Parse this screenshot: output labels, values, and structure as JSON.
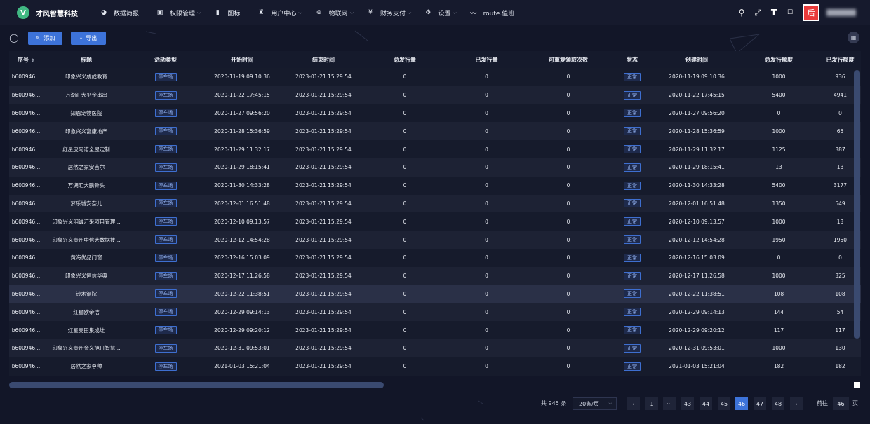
{
  "app": {
    "logo_letter": "V",
    "name": "才风智慧科技"
  },
  "menu": [
    {
      "icon": "dashboard-icon",
      "glyph": "◕",
      "label": "数据简报",
      "has_dropdown": false
    },
    {
      "icon": "lock-icon",
      "glyph": "▣",
      "label": "权限管理",
      "has_dropdown": true
    },
    {
      "icon": "image-icon",
      "glyph": "▮",
      "label": "图标",
      "has_dropdown": false
    },
    {
      "icon": "user-icon",
      "glyph": "♜",
      "label": "用户中心",
      "has_dropdown": true
    },
    {
      "icon": "network-icon",
      "glyph": "⊕",
      "label": "物联网",
      "has_dropdown": true
    },
    {
      "icon": "yen-icon",
      "glyph": "¥",
      "label": "财务支付",
      "has_dropdown": true
    },
    {
      "icon": "gear-icon",
      "glyph": "⚙",
      "label": "设置",
      "has_dropdown": true
    },
    {
      "icon": "route-icon",
      "glyph": "〰",
      "label": "route.值班",
      "has_dropdown": false
    }
  ],
  "header_right": {
    "avatar_glyph": "后"
  },
  "toolbar": {
    "add_label": "添加",
    "export_label": "导出"
  },
  "table": {
    "columns": [
      "序号",
      "标题",
      "活动类型",
      "开始时间",
      "结束时间",
      "总发行量",
      "已发行量",
      "可重复领取次数",
      "状态",
      "创建时间",
      "总发行额度",
      "已发行额度"
    ],
    "rows": [
      [
        "b600946...",
        "印象兴义成成教育",
        "停车场",
        "2020-11-19 09:10:36",
        "2023-01-21 15:29:54",
        "0",
        "0",
        "0",
        "正常",
        "2020-11-19 09:10:36",
        "1000",
        "936"
      ],
      [
        "b600946...",
        "万湖汇大平金串串",
        "停车场",
        "2020-11-22 17:45:15",
        "2023-01-21 15:29:54",
        "0",
        "0",
        "0",
        "正常",
        "2020-11-22 17:45:15",
        "5400",
        "4941"
      ],
      [
        "b600946...",
        "知恩宠物医院",
        "停车场",
        "2020-11-27 09:56:20",
        "2023-01-21 15:29:54",
        "0",
        "0",
        "0",
        "正常",
        "2020-11-27 09:56:20",
        "0",
        "0"
      ],
      [
        "b600946...",
        "印象兴义富康地产",
        "停车场",
        "2020-11-28 15:36:59",
        "2023-01-21 15:29:54",
        "0",
        "0",
        "0",
        "正常",
        "2020-11-28 15:36:59",
        "1000",
        "65"
      ],
      [
        "b600946...",
        "红星皮阿诺全屋定制",
        "停车场",
        "2020-11-29 11:32:17",
        "2023-01-21 15:29:54",
        "0",
        "0",
        "0",
        "正常",
        "2020-11-29 11:32:17",
        "1125",
        "387"
      ],
      [
        "b600946...",
        "居然之家安吉尔",
        "停车场",
        "2020-11-29 18:15:41",
        "2023-01-21 15:29:54",
        "0",
        "0",
        "0",
        "正常",
        "2020-11-29 18:15:41",
        "13",
        "13"
      ],
      [
        "b600946...",
        "万湖汇大鹏骨头",
        "停车场",
        "2020-11-30 14:33:28",
        "2023-01-21 15:29:54",
        "0",
        "0",
        "0",
        "正常",
        "2020-11-30 14:33:28",
        "5400",
        "3177"
      ],
      [
        "b600946...",
        "梦乐城安奈儿",
        "停车场",
        "2020-12-01 16:51:48",
        "2023-01-21 15:29:54",
        "0",
        "0",
        "0",
        "正常",
        "2020-12-01 16:51:48",
        "1350",
        "549"
      ],
      [
        "b600946...",
        "印象兴义明诚汇采项目管理...",
        "停车场",
        "2020-12-10 09:13:57",
        "2023-01-21 15:29:54",
        "0",
        "0",
        "0",
        "正常",
        "2020-12-10 09:13:57",
        "1000",
        "13"
      ],
      [
        "b600946...",
        "印象兴义贵州中信大数据技...",
        "停车场",
        "2020-12-12 14:54:28",
        "2023-01-21 15:29:54",
        "0",
        "0",
        "0",
        "正常",
        "2020-12-12 14:54:28",
        "1950",
        "1950"
      ],
      [
        "b600946...",
        "黄海优品门窗",
        "停车场",
        "2020-12-16 15:03:09",
        "2023-01-21 15:29:54",
        "0",
        "0",
        "0",
        "正常",
        "2020-12-16 15:03:09",
        "0",
        "0"
      ],
      [
        "b600946...",
        "印象兴义恒信华典",
        "停车场",
        "2020-12-17 11:26:58",
        "2023-01-21 15:29:54",
        "0",
        "0",
        "0",
        "正常",
        "2020-12-17 11:26:58",
        "1000",
        "325"
      ],
      [
        "b600946...",
        "铃木钢院",
        "停车场",
        "2020-12-22 11:38:51",
        "2023-01-21 15:29:54",
        "0",
        "0",
        "0",
        "正常",
        "2020-12-22 11:38:51",
        "108",
        "108"
      ],
      [
        "b600946...",
        "红星欧帝洁",
        "停车场",
        "2020-12-29 09:14:13",
        "2023-01-21 15:29:54",
        "0",
        "0",
        "0",
        "正常",
        "2020-12-29 09:14:13",
        "144",
        "54"
      ],
      [
        "b600946...",
        "红星奥田集成灶",
        "停车场",
        "2020-12-29 09:20:12",
        "2023-01-21 15:29:54",
        "0",
        "0",
        "0",
        "正常",
        "2020-12-29 09:20:12",
        "117",
        "117"
      ],
      [
        "b600946...",
        "印象兴义贵州金义旭日智慧...",
        "停车场",
        "2020-12-31 09:53:01",
        "2023-01-21 15:29:54",
        "0",
        "0",
        "0",
        "正常",
        "2020-12-31 09:53:01",
        "1000",
        "130"
      ],
      [
        "b600946...",
        "居然之家尊帅",
        "停车场",
        "2021-01-03 15:21:04",
        "2023-01-21 15:29:54",
        "0",
        "0",
        "0",
        "正常",
        "2021-01-03 15:21:04",
        "182",
        "182"
      ]
    ],
    "highlighted_row": 12
  },
  "pagination": {
    "total": "共 945 条",
    "page_size": "20条/页",
    "pages": [
      "1",
      "···",
      "43",
      "44",
      "45",
      "46",
      "47",
      "48"
    ],
    "current": "46",
    "goto_label": "前往",
    "goto_value": "46",
    "goto_unit": "页"
  }
}
